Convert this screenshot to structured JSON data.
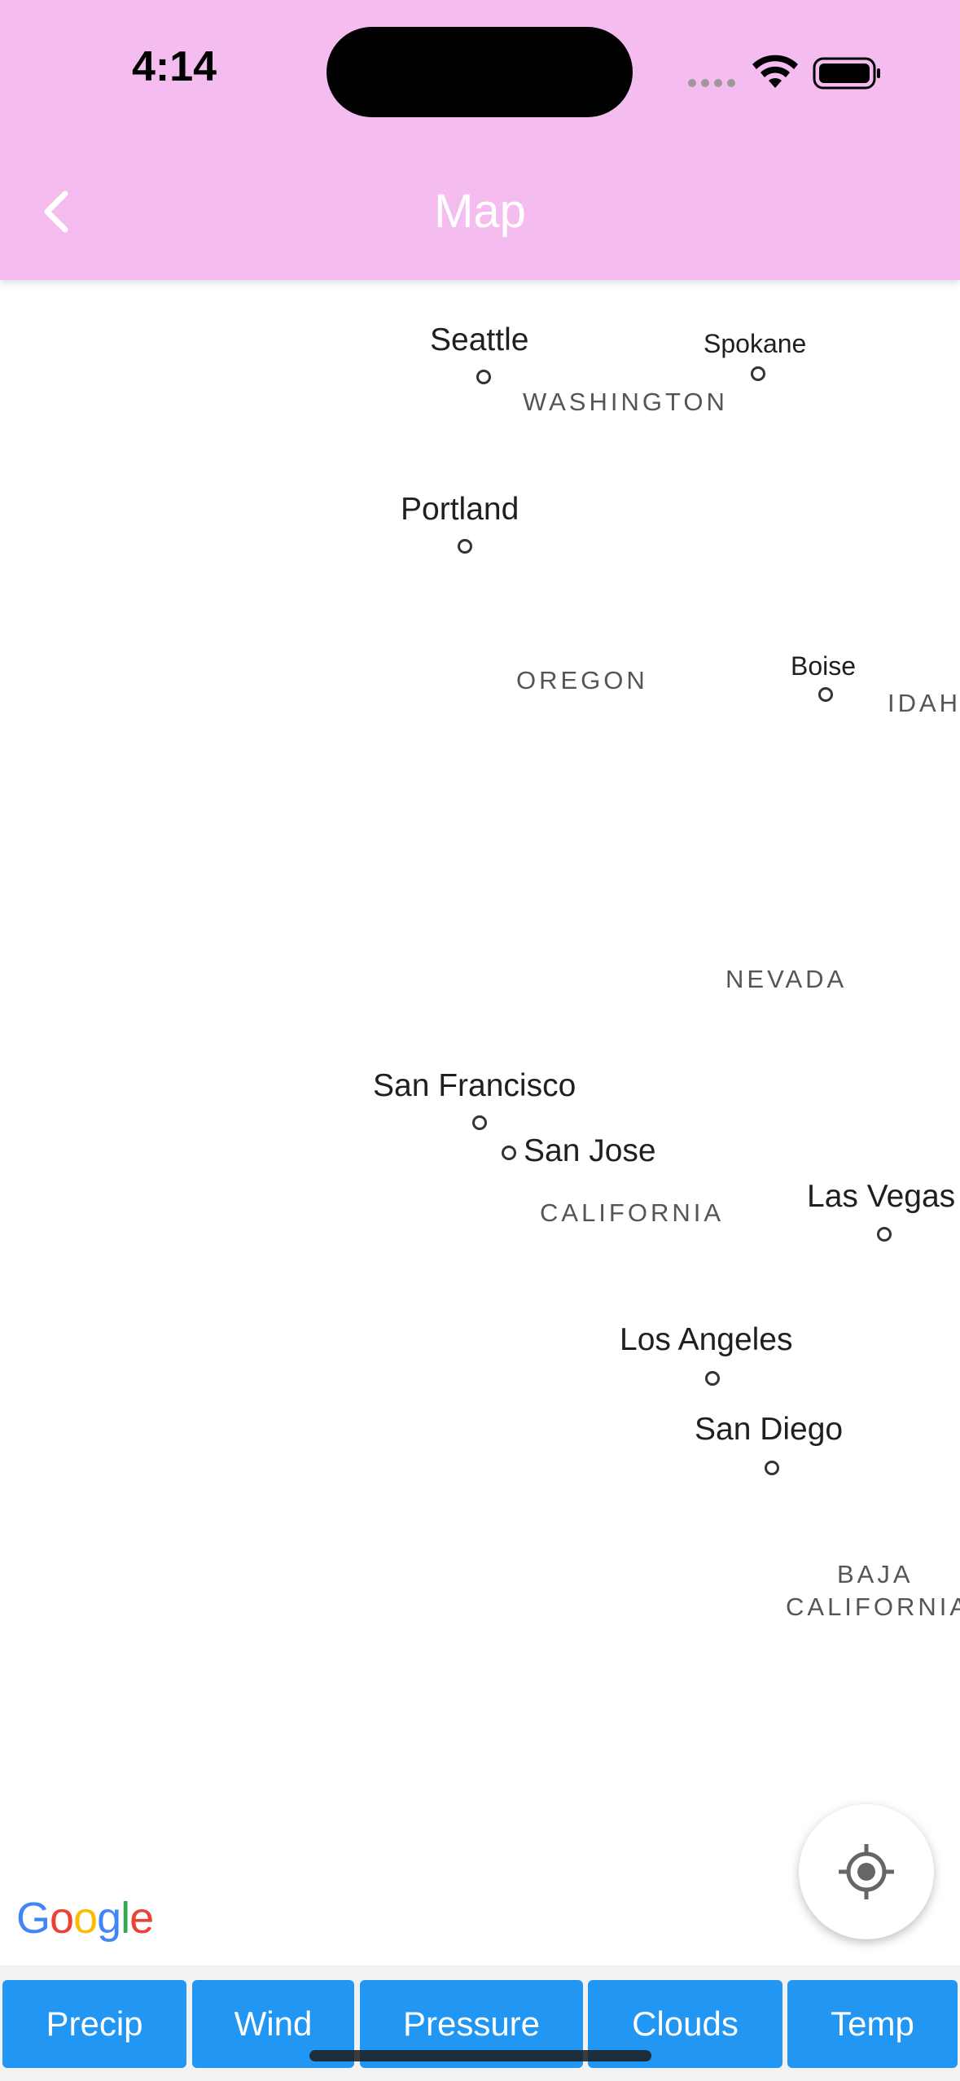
{
  "status_bar": {
    "time": "4:14"
  },
  "header": {
    "title": "Map"
  },
  "map": {
    "cities": {
      "seattle": "Seattle",
      "spokane": "Spokane",
      "portland": "Portland",
      "boise": "Boise",
      "san_francisco": "San Francisco",
      "san_jose": "San Jose",
      "las_vegas": "Las Vegas",
      "los_angeles": "Los Angeles",
      "san_diego": "San Diego"
    },
    "states": {
      "washington": "WASHINGTON",
      "oregon": "OREGON",
      "idaho": "IDAH",
      "nevada": "NEVADA",
      "california": "CALIFORNIA",
      "baja_line1": "BAJA",
      "baja_line2": "CALIFORNIA"
    },
    "attribution": "Google"
  },
  "toolbar": {
    "precip": "Precip",
    "wind": "Wind",
    "pressure": "Pressure",
    "clouds": "Clouds",
    "temp": "Temp"
  },
  "colors": {
    "header": "#f5bcf0",
    "button": "#2196f3"
  }
}
